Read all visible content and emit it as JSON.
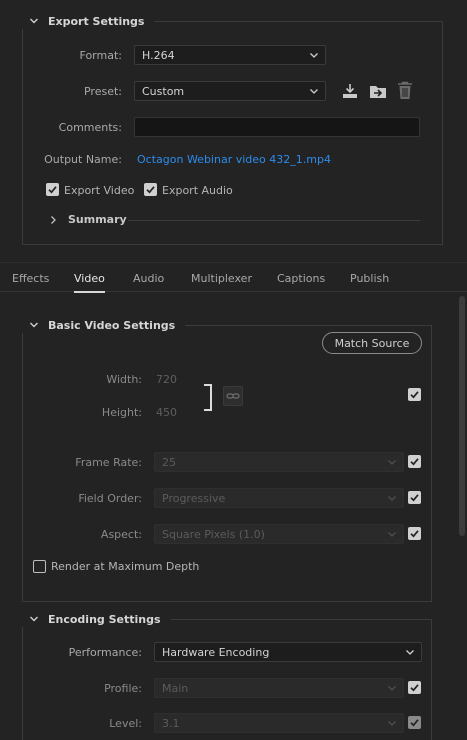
{
  "export_settings": {
    "title": "Export Settings",
    "format_label": "Format:",
    "format_value": "H.264",
    "preset_label": "Preset:",
    "preset_value": "Custom",
    "comments_label": "Comments:",
    "comments_value": "",
    "output_name_label": "Output Name:",
    "output_name_value": "Octagon Webinar video 432_1.mp4",
    "export_video_label": "Export Video",
    "export_video_checked": true,
    "export_audio_label": "Export Audio",
    "export_audio_checked": true,
    "summary_label": "Summary"
  },
  "tabs": [
    {
      "label": "Effects",
      "active": false
    },
    {
      "label": "Video",
      "active": true
    },
    {
      "label": "Audio",
      "active": false
    },
    {
      "label": "Multiplexer",
      "active": false
    },
    {
      "label": "Captions",
      "active": false
    },
    {
      "label": "Publish",
      "active": false
    }
  ],
  "basic_video": {
    "title": "Basic Video Settings",
    "match_source_label": "Match Source",
    "width_label": "Width:",
    "width_value": "720",
    "height_label": "Height:",
    "height_value": "450",
    "frame_rate_label": "Frame Rate:",
    "frame_rate_value": "25",
    "field_order_label": "Field Order:",
    "field_order_value": "Progressive",
    "aspect_label": "Aspect:",
    "aspect_value": "Square Pixels (1.0)",
    "render_max_depth_label": "Render at Maximum Depth"
  },
  "encoding": {
    "title": "Encoding Settings",
    "performance_label": "Performance:",
    "performance_value": "Hardware Encoding",
    "profile_label": "Profile:",
    "profile_value": "Main",
    "level_label": "Level:",
    "level_value": "3.1"
  },
  "icons": {
    "save_preset": "download-icon",
    "import_preset": "import-icon",
    "delete_preset": "trash-icon",
    "link": "chain-link-icon"
  },
  "colors": {
    "accent_link": "#2d8ceb",
    "background": "#232323"
  }
}
